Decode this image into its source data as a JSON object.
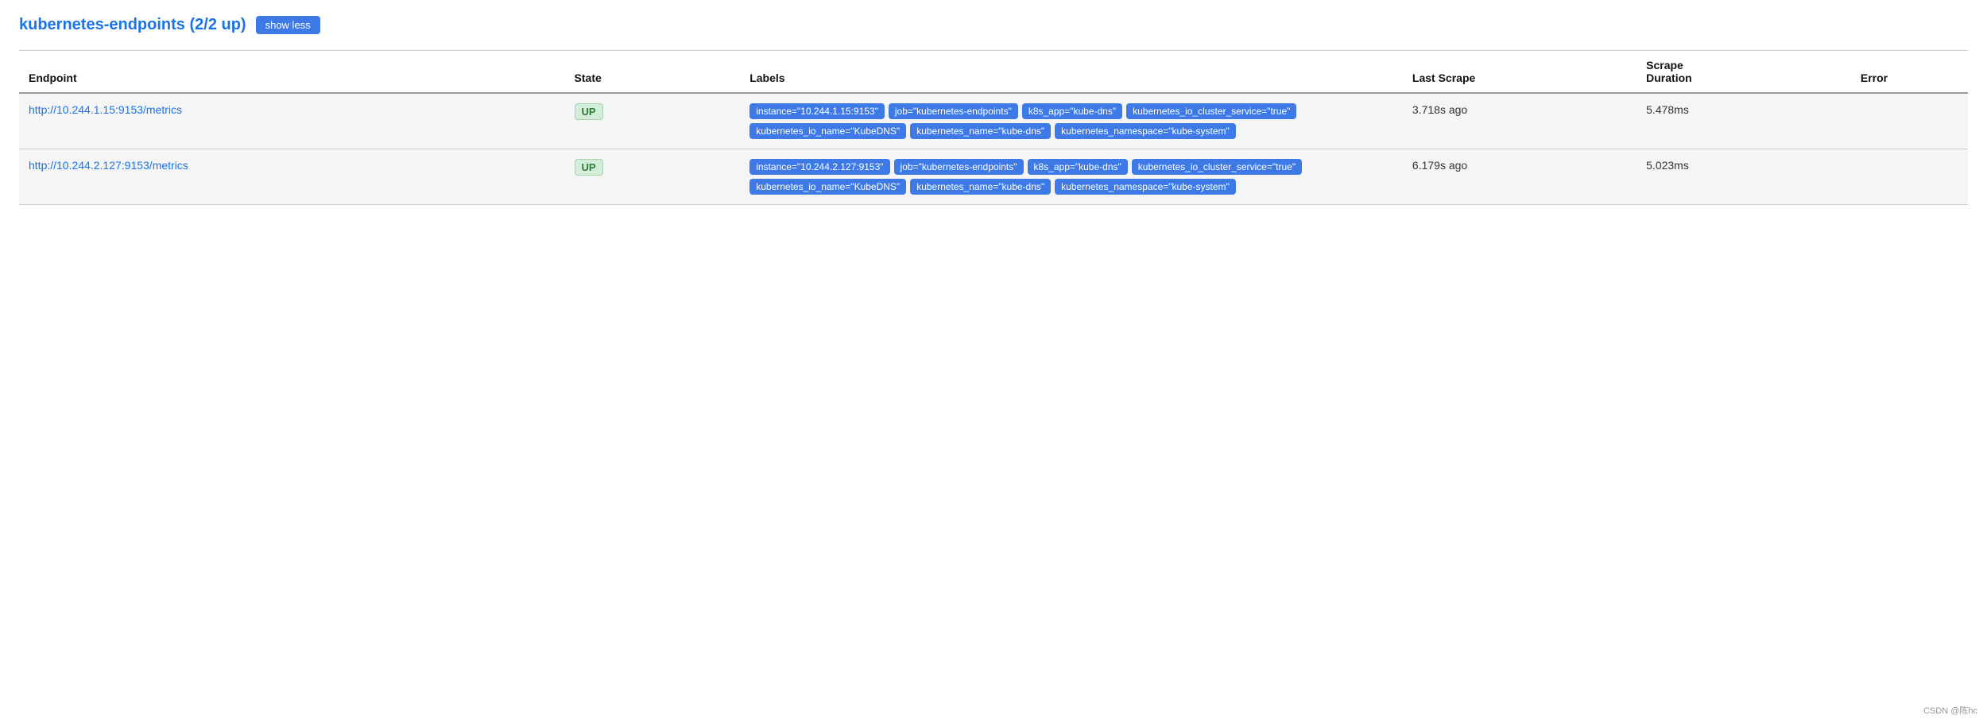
{
  "header": {
    "title": "kubernetes-endpoints (2/2 up)",
    "show_less_label": "show less"
  },
  "table": {
    "columns": [
      {
        "key": "endpoint",
        "label": "Endpoint"
      },
      {
        "key": "state",
        "label": "State"
      },
      {
        "key": "labels",
        "label": "Labels"
      },
      {
        "key": "last_scrape",
        "label": "Last Scrape"
      },
      {
        "key": "scrape_duration",
        "label": "Scrape Duration"
      },
      {
        "key": "error",
        "label": "Error"
      }
    ],
    "rows": [
      {
        "endpoint_url": "http://10.244.1.15:9153/metrics",
        "state": "UP",
        "labels": [
          "instance=\"10.244.1.15:9153\"",
          "job=\"kubernetes-endpoints\"",
          "k8s_app=\"kube-dns\"",
          "kubernetes_io_cluster_service=\"true\"",
          "kubernetes_io_name=\"KubeDNS\"",
          "kubernetes_name=\"kube-dns\"",
          "kubernetes_namespace=\"kube-system\""
        ],
        "last_scrape": "3.718s ago",
        "scrape_duration": "5.478ms",
        "error": ""
      },
      {
        "endpoint_url": "http://10.244.2.127:9153/metrics",
        "state": "UP",
        "labels": [
          "instance=\"10.244.2.127:9153\"",
          "job=\"kubernetes-endpoints\"",
          "k8s_app=\"kube-dns\"",
          "kubernetes_io_cluster_service=\"true\"",
          "kubernetes_io_name=\"KubeDNS\"",
          "kubernetes_name=\"kube-dns\"",
          "kubernetes_namespace=\"kube-system\""
        ],
        "last_scrape": "6.179s ago",
        "scrape_duration": "5.023ms",
        "error": ""
      }
    ]
  },
  "watermark": "CSDN @陈hc"
}
